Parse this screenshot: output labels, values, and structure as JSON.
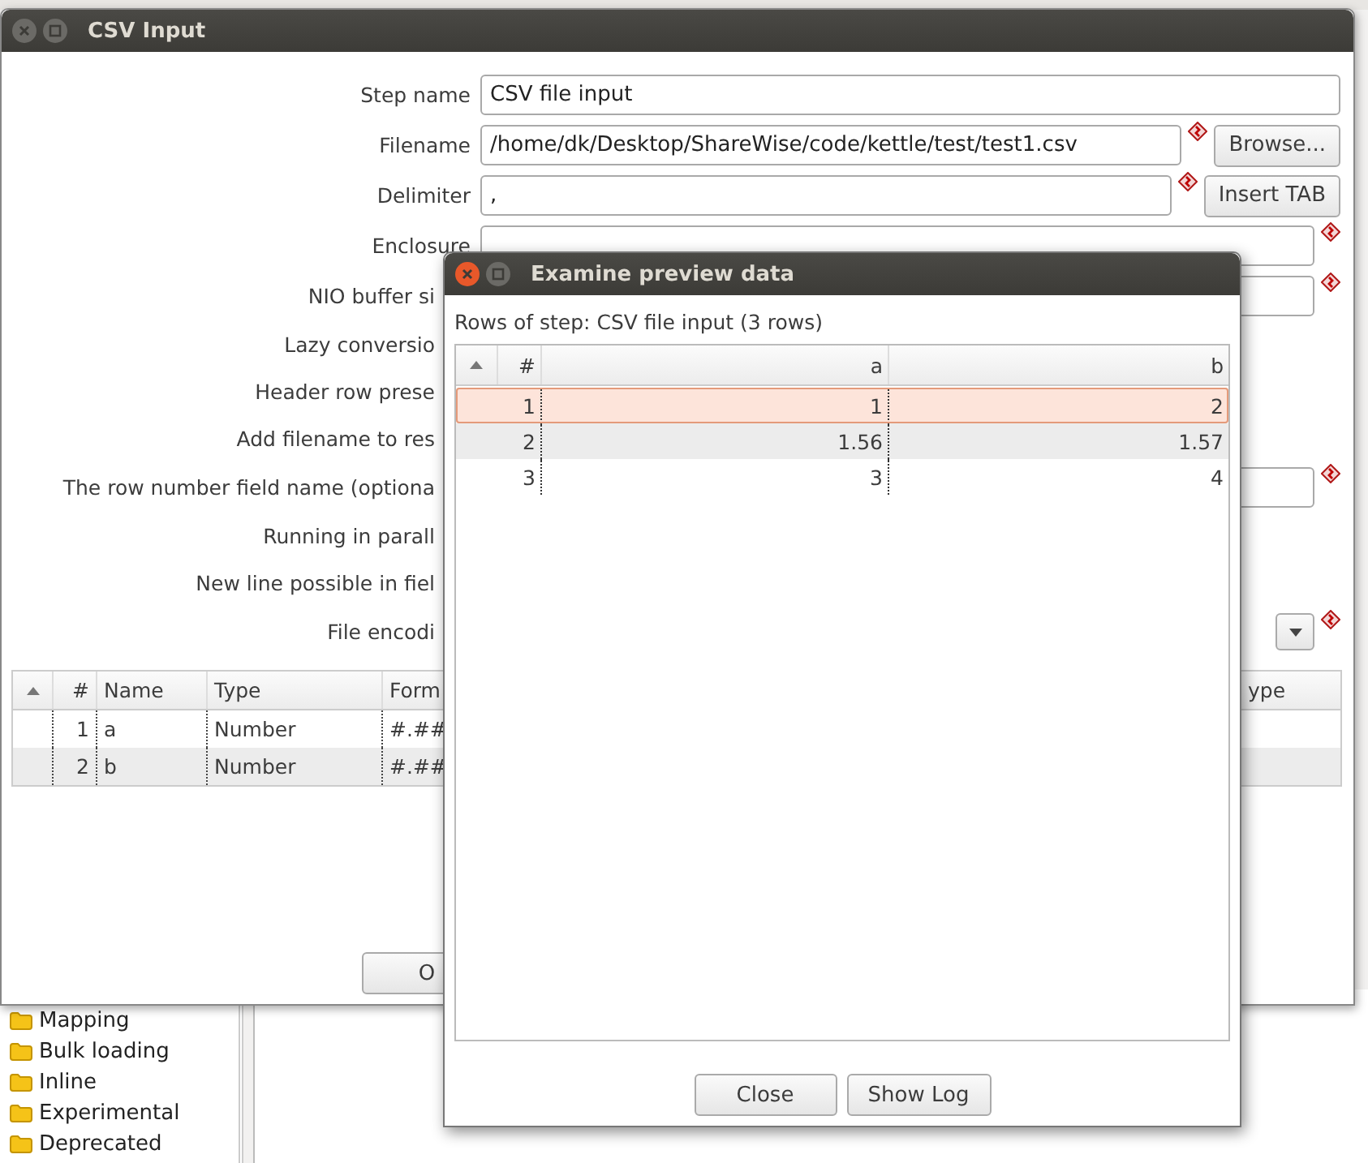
{
  "step_tree": {
    "items": [
      {
        "label": "Mapping"
      },
      {
        "label": "Bulk loading"
      },
      {
        "label": "Inline"
      },
      {
        "label": "Experimental"
      },
      {
        "label": "Deprecated"
      }
    ]
  },
  "csv_input_window": {
    "title": "CSV Input",
    "fields": [
      {
        "kind": "text",
        "label": "Step name",
        "value": "CSV file input",
        "warning": false
      },
      {
        "kind": "text",
        "label": "Filename",
        "value": "/home/dk/Desktop/ShareWise/code/kettle/test/test1.csv",
        "warning": true,
        "button": "Browse..."
      },
      {
        "kind": "text",
        "label": "Delimiter",
        "value": ",",
        "warning": true,
        "button": "Insert TAB"
      },
      {
        "kind": "text",
        "label": "Enclosure",
        "warning": true
      },
      {
        "kind": "text",
        "label": "NIO buffer si",
        "warning": true
      },
      {
        "label": "Lazy conversio"
      },
      {
        "label": "Header row prese"
      },
      {
        "label": "Add filename to res"
      },
      {
        "kind": "text",
        "label": "The row number field name (optiona",
        "warning": true
      },
      {
        "label": "Running in parall"
      },
      {
        "label": "New line possible in fiel"
      },
      {
        "kind": "dropdown",
        "label": "File encodi",
        "warning": true
      }
    ],
    "fields_table": {
      "columns": [
        "#",
        "Name",
        "Type",
        "Form",
        "ype"
      ],
      "rows": [
        [
          "1",
          "a",
          "Number",
          "#.##"
        ],
        [
          "2",
          "b",
          "Number",
          "#.##"
        ]
      ]
    },
    "buttons": [
      "O"
    ]
  },
  "preview_window": {
    "title": "Examine preview data",
    "caption": "Rows of step: CSV file input (3 rows)",
    "table": {
      "columns": [
        "#",
        "a",
        "b"
      ],
      "rows": [
        {
          "cells": [
            "1",
            "1",
            "2"
          ],
          "selected": true
        },
        {
          "cells": [
            "2",
            "1.56",
            "1.57"
          ],
          "selected": false
        },
        {
          "cells": [
            "3",
            "3",
            "4"
          ],
          "selected": false
        }
      ]
    },
    "buttons": [
      "Close",
      "Show Log"
    ]
  }
}
